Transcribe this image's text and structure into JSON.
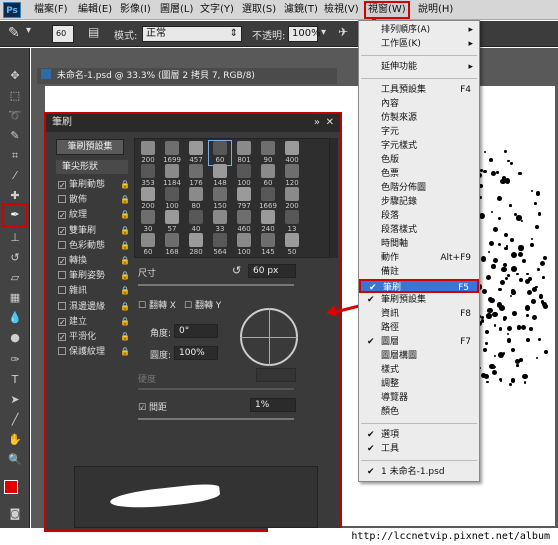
{
  "app": {
    "logo": "Ps"
  },
  "menubar": {
    "items": [
      "檔案(F)",
      "編輯(E)",
      "影像(I)",
      "圖層(L)",
      "文字(Y)",
      "選取(S)",
      "濾鏡(T)",
      "檢視(V)",
      "視窗(W)",
      "說明(H)"
    ]
  },
  "options": {
    "brush_size": "60",
    "mode_label": "模式:",
    "mode_value": "正常",
    "opacity_label": "不透明:",
    "opacity_value": "100%"
  },
  "document": {
    "tab_title": "未命名-1.psd @ 33.3% (圖層 2 拷貝 7, RGB/8)"
  },
  "brush_panel": {
    "title": "筆刷",
    "preset_button": "筆刷預設集",
    "shape_header": "筆尖形狀",
    "options": [
      {
        "label": "筆刷動態",
        "checked": true
      },
      {
        "label": "散佈",
        "checked": false
      },
      {
        "label": "紋理",
        "checked": true
      },
      {
        "label": "雙筆刷",
        "checked": true
      },
      {
        "label": "色彩動態",
        "checked": false
      },
      {
        "label": "轉換",
        "checked": true
      },
      {
        "label": "筆刷姿勢",
        "checked": false
      },
      {
        "label": "雜訊",
        "checked": false
      },
      {
        "label": "濕邊邊緣",
        "checked": false
      },
      {
        "label": "建立",
        "checked": true
      },
      {
        "label": "平滑化",
        "checked": true
      },
      {
        "label": "保護紋理",
        "checked": false
      }
    ],
    "tips": [
      "200",
      "1699",
      "457",
      "60",
      "801",
      "90",
      "400",
      "353",
      "1184",
      "176",
      "148",
      "100",
      "60",
      "120",
      "200",
      "100",
      "80",
      "150",
      "797",
      "1669",
      "200",
      "30",
      "57",
      "40",
      "33",
      "460",
      "240",
      "13",
      "60",
      "168",
      "280",
      "564",
      "100",
      "145",
      "50"
    ],
    "size_label": "尺寸",
    "size_value": "60 px",
    "flip_x": "翻轉 X",
    "flip_y": "翻轉 Y",
    "angle_label": "角度:",
    "angle_value": "0°",
    "roundness_label": "圓度:",
    "roundness_value": "100%",
    "hardness_label": "硬度",
    "spacing_label": "間距",
    "spacing_value": "1%"
  },
  "window_menu": {
    "items": [
      {
        "label": "排列順序(A)",
        "submenu": true
      },
      {
        "label": "工作區(K)",
        "submenu": true
      },
      {
        "sep": true
      },
      {
        "label": "延伸功能",
        "submenu": true
      },
      {
        "sep": true
      },
      {
        "label": "工具預設集",
        "shortcut": "F4"
      },
      {
        "label": "內容"
      },
      {
        "label": "仿製來源"
      },
      {
        "label": "字元"
      },
      {
        "label": "字元樣式"
      },
      {
        "label": "色版"
      },
      {
        "label": "色票"
      },
      {
        "label": "色階分佈圖"
      },
      {
        "label": "步驟記錄"
      },
      {
        "label": "段落"
      },
      {
        "label": "段落樣式"
      },
      {
        "label": "時間軸"
      },
      {
        "label": "動作",
        "shortcut": "Alt+F9"
      },
      {
        "label": "備註"
      },
      {
        "label": "筆刷",
        "shortcut": "F5",
        "checked": true,
        "highlight": true
      },
      {
        "label": "筆刷預設集",
        "checked": true
      },
      {
        "label": "資訊",
        "shortcut": "F8"
      },
      {
        "label": "路徑"
      },
      {
        "label": "圖層",
        "shortcut": "F7",
        "checked": true
      },
      {
        "label": "圖層構圖"
      },
      {
        "label": "樣式"
      },
      {
        "label": "調整"
      },
      {
        "label": "導覽器"
      },
      {
        "label": "顏色"
      },
      {
        "sep": true
      },
      {
        "label": "選項",
        "checked": true
      },
      {
        "label": "工具",
        "checked": true
      },
      {
        "sep": true
      },
      {
        "label": "1 未命名-1.psd",
        "checked": true
      }
    ]
  },
  "watermark": "http://lccnetvip.pixnet.net/album",
  "colors": {
    "highlight": "#3875d7",
    "annotation": "#e00000",
    "foreground": "#e00000"
  }
}
